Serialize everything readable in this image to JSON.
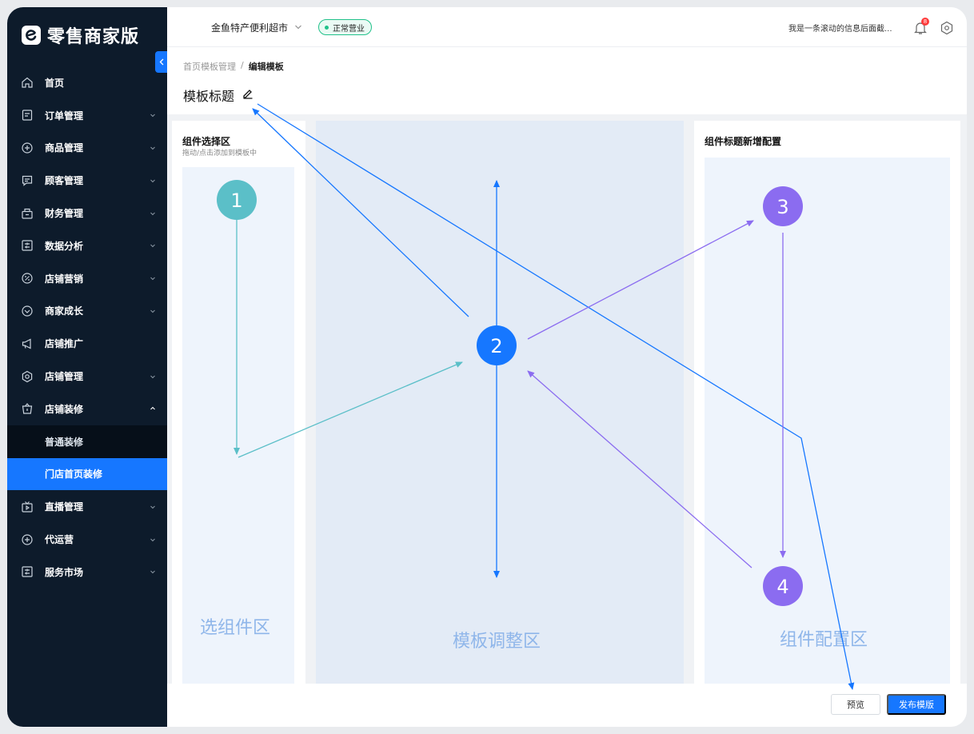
{
  "app": {
    "logo_text": "零售商家版"
  },
  "sidebar": {
    "items": [
      {
        "label": "首页",
        "icon": "home-icon",
        "has_chevron": false
      },
      {
        "label": "订单管理",
        "icon": "order-icon",
        "has_chevron": true
      },
      {
        "label": "商品管理",
        "icon": "product-icon",
        "has_chevron": true
      },
      {
        "label": "顾客管理",
        "icon": "customer-icon",
        "has_chevron": true
      },
      {
        "label": "财务管理",
        "icon": "finance-icon",
        "has_chevron": true
      },
      {
        "label": "数据分析",
        "icon": "data-icon",
        "has_chevron": true
      },
      {
        "label": "店铺营销",
        "icon": "marketing-icon",
        "has_chevron": true
      },
      {
        "label": "商家成长",
        "icon": "growth-icon",
        "has_chevron": true
      },
      {
        "label": "店铺推广",
        "icon": "promotion-icon",
        "has_chevron": false
      },
      {
        "label": "店铺管理",
        "icon": "store-settings-icon",
        "has_chevron": true
      },
      {
        "label": "店铺装修",
        "icon": "decoration-icon",
        "has_chevron": true,
        "expanded": true
      }
    ],
    "subitems": [
      {
        "label": "普通装修",
        "active": false
      },
      {
        "label": "门店首页装修",
        "active": true
      }
    ],
    "items_after": [
      {
        "label": "直播管理",
        "icon": "live-icon",
        "has_chevron": true
      },
      {
        "label": "代运营",
        "icon": "operation-icon",
        "has_chevron": true
      },
      {
        "label": "服务市场",
        "icon": "market-icon",
        "has_chevron": true
      }
    ]
  },
  "header": {
    "store_name": "金鱼特产便利超市",
    "status": "正常营业",
    "marquee": "我是一条滚动的信息后面截...",
    "notification_count": "8"
  },
  "page": {
    "breadcrumb": [
      "首页模板管理",
      "编辑模板"
    ],
    "breadcrumb_sep": "/",
    "title": "模板标题"
  },
  "panels": {
    "left_title": "组件选择区",
    "left_subtitle": "拖动/点击添加到模板中",
    "left_zone_label": "选组件区",
    "mid_zone_label": "模板调整区",
    "right_title": "组件标题新增配置",
    "right_zone_label": "组件配置区"
  },
  "footer": {
    "preview": "预览",
    "publish": "发布模版"
  },
  "annotations": {
    "markers": [
      "1",
      "2",
      "3",
      "4"
    ],
    "colors": {
      "teal": "#5bbfc8",
      "blue": "#1677ff",
      "purple": "#8b6cf0"
    }
  },
  "colors": {
    "sidebar_bg": "#0d1b2b",
    "accent": "#1677ff",
    "status_green": "#21c18a"
  }
}
